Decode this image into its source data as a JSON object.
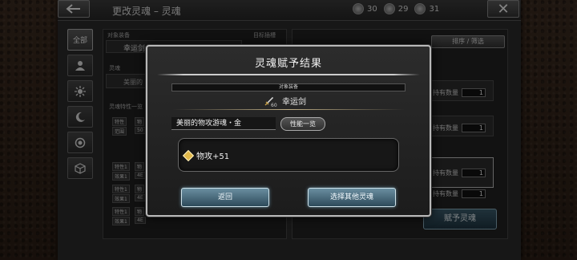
{
  "header": {
    "title": "更改灵魂 – 灵魂",
    "counters": [
      {
        "icon": "soul-a-icon",
        "value": "30"
      },
      {
        "icon": "soul-b-icon",
        "value": "29"
      },
      {
        "icon": "soul-c-icon",
        "value": "31"
      }
    ]
  },
  "tabs": [
    {
      "label": "全部"
    },
    {
      "icon": "person-icon"
    },
    {
      "icon": "sun-icon"
    },
    {
      "icon": "moon-icon"
    },
    {
      "icon": "circle-icon"
    },
    {
      "icon": "cube-icon"
    }
  ],
  "background": {
    "target_label": "对象装备",
    "slot_label": "目标插槽",
    "weapon_name": "幸运剑",
    "soul_label": "灵魂",
    "soul_partial": "美丽的",
    "trait_label": "灵魂特性一览",
    "sort_label": "排序 / 筛选",
    "qty_label": "持有数量",
    "qty_values": [
      "1",
      "1",
      "1",
      "1"
    ],
    "assign_button": "赋予灵魂",
    "chips": [
      "特性",
      "物",
      "范围",
      "50",
      "特性1",
      "物",
      "效果1",
      "4E",
      "特性1",
      "物",
      "效果1",
      "4E",
      "特性1",
      "物",
      "效果1",
      "4E"
    ]
  },
  "modal": {
    "title": "灵魂赋予结果",
    "target_header": "对象装备",
    "weapon_level": "60",
    "weapon_name": "幸运剑",
    "soul_name": "美丽的物攻游魂・金",
    "performance_button": "性能一览",
    "effect": "物攻+51",
    "return_button": "返回",
    "other_button": "选择其他灵魂"
  },
  "colors": {
    "modal_border": "#b9b9b9",
    "button_blue": "#4a6e80",
    "gem_gold": "#e0b84a"
  }
}
